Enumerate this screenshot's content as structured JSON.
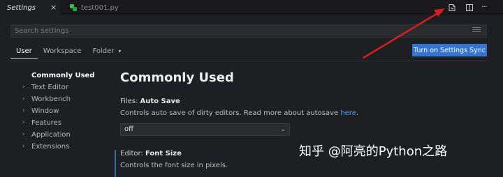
{
  "tabs": {
    "active_label": "Settings",
    "active_close": "×",
    "inactive_label": "test001.py"
  },
  "toolbar": {
    "icons": [
      "open-settings-json-icon",
      "split-editor-icon",
      "more-actions-icon"
    ],
    "more_label": "···"
  },
  "search": {
    "placeholder": "Search settings"
  },
  "scope": {
    "user": "User",
    "workspace": "Workspace",
    "folder": "Folder",
    "folder_caret": "▾"
  },
  "sync_button": {
    "label": "Turn on Settings Sync",
    "color": "#3374d6"
  },
  "annotation": {
    "arrow_color": "#d11f1f"
  },
  "toc": {
    "header": "Commonly Used",
    "items": [
      "Text Editor",
      "Workbench",
      "Window",
      "Features",
      "Application",
      "Extensions"
    ]
  },
  "main": {
    "section_title": "Commonly Used",
    "auto_save": {
      "category": "Files: ",
      "name": "Auto Save",
      "description": "Controls auto save of dirty editors. Read more about autosave ",
      "link": "here",
      "period": ".",
      "value": "off"
    },
    "font_size": {
      "category": "Editor: ",
      "name": "Font Size",
      "description": "Controls the font size in pixels."
    }
  },
  "watermark": "知乎 @阿亮的Python之路"
}
